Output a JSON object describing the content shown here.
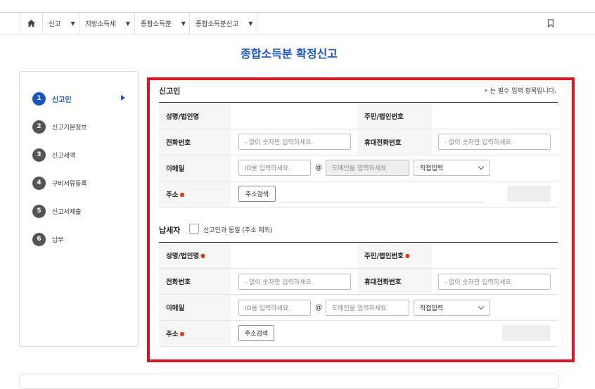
{
  "breadcrumb": {
    "items": [
      {
        "label": "신고"
      },
      {
        "label": "지방소득세"
      },
      {
        "label": "종합소득분"
      },
      {
        "label": "종합소득분신고"
      }
    ]
  },
  "page_title": "종합소득분 확정신고",
  "steps": [
    {
      "num": "1",
      "label": "신고인",
      "active": true
    },
    {
      "num": "2",
      "label": "신고기본정보"
    },
    {
      "num": "3",
      "label": "신고세액"
    },
    {
      "num": "4",
      "label": "구비서류등록"
    },
    {
      "num": "5",
      "label": "신고서제출"
    },
    {
      "num": "6",
      "label": "납부"
    }
  ],
  "reporter": {
    "title": "신고인",
    "required_note": "는 필수 입력 항목입니다.",
    "name_label": "성명/법인명",
    "id_label": "주민/법인번호",
    "phone_label": "전화번호",
    "phone_placeholder": "- 없이 숫자만 입력하세요.",
    "mobile_label": "휴대전화번호",
    "mobile_placeholder": "- 없이 숫자만 입력하세요.",
    "email_label": "이메일",
    "email_id_placeholder": "ID를 입력하세요.",
    "at": "@",
    "email_domain_placeholder": "도메인을 입력하세요.",
    "email_select": "직접입력",
    "address_label": "주소",
    "address_button": "주소검색"
  },
  "taxpayer": {
    "title": "납세자",
    "same_as_label": "신고인과 동일 (주소 제외)",
    "name_label": "성명/법인명",
    "id_label": "주민/법인번호",
    "phone_label": "전화번호",
    "phone_placeholder": "- 없이 숫자만 입력하세요.",
    "mobile_label": "휴대전화번호",
    "mobile_placeholder": "- 없이 숫자만 입력하세요.",
    "email_label": "이메일",
    "email_id_placeholder": "ID를 입력하세요.",
    "at": "@",
    "email_domain_placeholder": "도메인을 입력하세요.",
    "email_select": "직접입력",
    "address_label": "주소",
    "address_button": "주소검색"
  },
  "colors": {
    "accent": "#1a55c4",
    "highlight": "#e0141c",
    "required": "#e03a1a"
  }
}
